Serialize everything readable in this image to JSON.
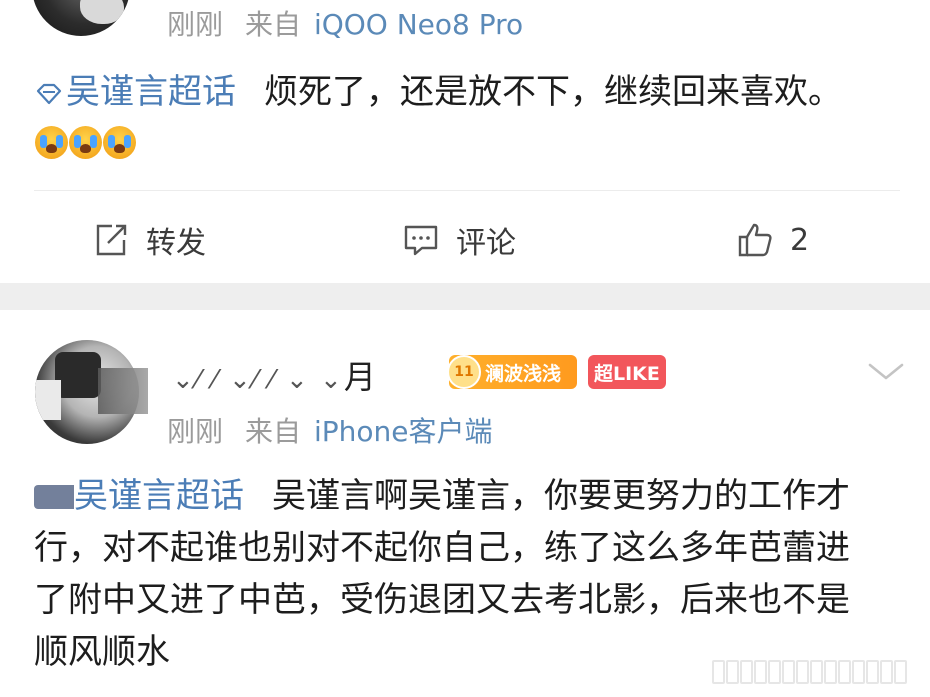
{
  "post1": {
    "time": "刚刚",
    "source_prefix": "来自",
    "device": "iQOO Neo8 Pro",
    "topic": "吴谨言超话",
    "text": "烦死了，还是放不下，继续回来喜欢。",
    "emoji_icons": [
      "crying-face-icon",
      "crying-face-icon",
      "crying-face-icon"
    ],
    "actions": {
      "repost_label": "转发",
      "comment_label": "评论",
      "like_count": "2"
    }
  },
  "post2": {
    "name_masked": "⌄⁄ ⁄ ⌄⁄ ⁄ ⌄ ⌄",
    "name_visible_end": "月",
    "fan_level": "11",
    "fan_badge": "澜波浅浅",
    "like_badge": "超LIKE",
    "time": "刚刚",
    "source_prefix": "来自",
    "device": "iPhone客户端",
    "topic": "吴谨言超话",
    "text": "吴谨言啊吴谨言，你要更努力的工作才行，对不起谁也别对不起你自己，练了这么多年芭蕾进了附中又进了中芭，受伤退团又去考北影，后来也不是顺风顺水"
  },
  "colors": {
    "link": "#4b7db6",
    "meta": "#9b9b9b",
    "fan_badge": "#ffa126",
    "like_badge": "#f2565b",
    "separator": "#eeeeee"
  }
}
